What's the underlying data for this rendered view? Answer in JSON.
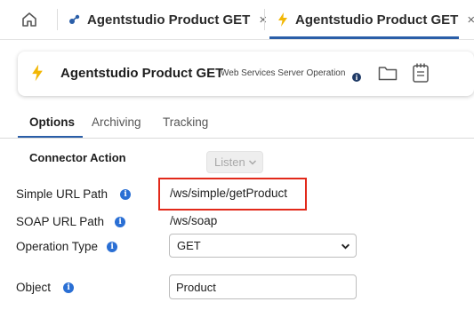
{
  "tabs": [
    {
      "label": "Agentstudio Product GET",
      "icon": "connector-icon",
      "close": "×",
      "active": false
    },
    {
      "label": "Agentstudio Product GET",
      "icon": "lightning-icon",
      "close": "×",
      "active": true
    }
  ],
  "header": {
    "title": "Agentstudio Product GET",
    "subtitle": "Web Services Server Operation",
    "icons": [
      "lightning-icon",
      "info-icon",
      "folder-icon",
      "notebook-icon"
    ]
  },
  "subtabs": [
    "Options",
    "Archiving",
    "Tracking"
  ],
  "form": {
    "connector_action_label": "Connector Action",
    "connector_action_value": "Listen",
    "simple_url_label": "Simple URL Path",
    "simple_url_value": "/ws/simple/getProduct",
    "soap_url_label": "SOAP URL Path",
    "soap_url_value": "/ws/soap",
    "operation_type_label": "Operation Type",
    "operation_type_value": "GET",
    "object_label": "Object",
    "object_value": "Product"
  },
  "colors": {
    "accent": "#2a5ea8",
    "info": "#2a6fd4",
    "highlight": "#e2291a",
    "bolt": "#f2b705"
  }
}
